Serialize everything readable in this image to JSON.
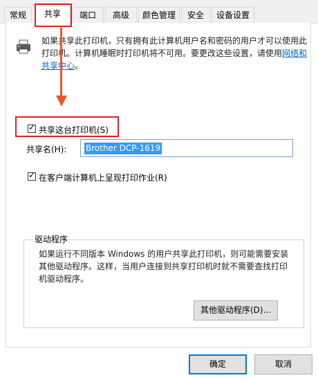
{
  "tabs": [
    "常规",
    "共享",
    "端口",
    "高级",
    "颜色管理",
    "安全",
    "设备设置"
  ],
  "description": {
    "text": "如果共享此打印机，只有拥有此计算机用户名和密码的用户才可以使用此打印机。计算机睡眠时打印机将不可用。要更改这些设置，请使用",
    "link": "网络和共享中心",
    "end": "。"
  },
  "share_checkbox": {
    "label": "共享这台打印机(S)",
    "checked": true
  },
  "share_name": {
    "label": "共享名(H):",
    "value": "Brother DCP-1619"
  },
  "render_checkbox": {
    "label": "在客户端计算机上呈现打印作业(R)",
    "checked": true
  },
  "drivers": {
    "title": "驱动程序",
    "text": "如果运行不同版本 Windows 的用户共享此打印机，则可能需要安装其他驱动程序。这样，当用户连接到共享打印机时就不需要查找打印机驱动程序。",
    "button": "其他驱动程序(D)..."
  },
  "ok_label": "确定",
  "cancel_label": "取消",
  "colors": {
    "highlight": "#e02020",
    "arrow": "#e6562f",
    "link": "#0066cc"
  }
}
